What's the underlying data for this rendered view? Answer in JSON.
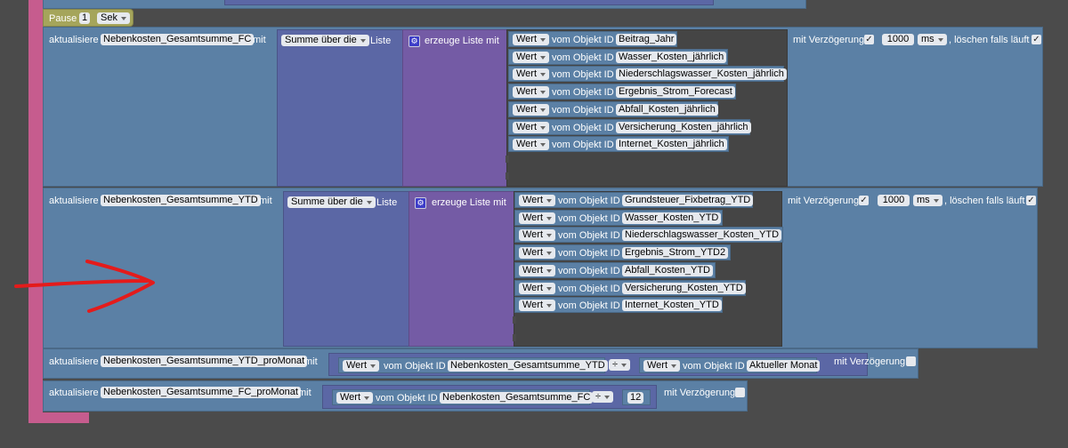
{
  "pause": {
    "label": "Pause",
    "value": "1",
    "unit": "Sek"
  },
  "common": {
    "aktualisiere": "aktualisiere",
    "mit": "mit",
    "summe": "Summe über die",
    "liste": "Liste",
    "erzeuge": "erzeuge Liste mit",
    "wert": "Wert",
    "vom": "vom Objekt ID",
    "verz": "mit Verzögerung",
    "delay": "1000",
    "ms": "ms",
    "loeschen": ", löschen falls läuft",
    "div": "÷",
    "check": "✓",
    "gear": "⚙"
  },
  "block_fc": {
    "target": "Nebenkosten_Gesamtsumme_FC",
    "items": [
      "Beitrag_Jahr",
      "Wasser_Kosten_jährlich",
      "Niederschlagswasser_Kosten_jährlich",
      "Ergebnis_Strom_Forecast",
      "Abfall_Kosten_jährlich",
      "Versicherung_Kosten_jährlich",
      "Internet_Kosten_jährlich"
    ]
  },
  "block_ytd": {
    "target": "Nebenkosten_Gesamtsumme_YTD",
    "items": [
      "Grundsteuer_Fixbetrag_YTD",
      "Wasser_Kosten_YTD",
      "Niederschlagswasser_Kosten_YTD",
      "Ergebnis_Strom_YTD2",
      "Abfall_Kosten_YTD",
      "Versicherung_Kosten_YTD",
      "Internet_Kosten_YTD"
    ]
  },
  "block_ytd_month": {
    "target": "Nebenkosten_Gesamtsumme_YTD_proMonat",
    "obj1": "Nebenkosten_Gesamtsumme_YTD",
    "obj2": "Aktueller Monat"
  },
  "block_fc_month": {
    "target": "Nebenkosten_Gesamtsumme_FC_proMonat",
    "obj1": "Nebenkosten_Gesamtsumme_FC",
    "number": "12"
  },
  "colors": {
    "annotation_arrow": "#e41b1b"
  }
}
